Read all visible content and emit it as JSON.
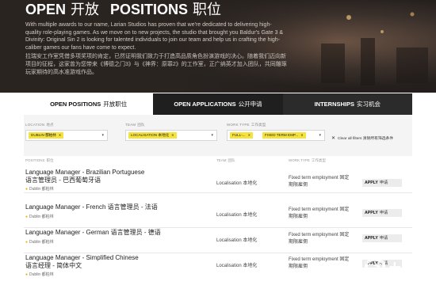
{
  "hero": {
    "title_open": "OPEN",
    "title_open_cn": "开放",
    "title_positions": "POSITIONS",
    "title_positions_cn": "职位",
    "intro_en": "With multiple awards to our name, Larian Studios has proven that we're dedicated to delivering high-quality role-playing games. As we move on to new projects, the studio that brought you Baldur's Gate 3 & Divinity: Original Sin 2 is looking for talented individuals to join our team and help us in crafting the high-caliber games our fans have come to expect.",
    "intro_cn": "拉瑞安工作室凭借多项奖项的肯定，已然证明我们致力于打造高品质角色扮演游戏的决心。随着我们迈向新项目的征程，这家曾为您带来《博德之门3》与《神界：原罪2》的工作室，正广纳英才加入团队，共同雕琢玩家期待的高水准游戏作品。"
  },
  "tabs": [
    {
      "label": "OPEN POSITIONS",
      "label_cn": "开放职位"
    },
    {
      "label": "OPEN APPLICATIONS",
      "label_cn": "公开申请"
    },
    {
      "label": "INTERNSHIPS",
      "label_cn": "实习机会"
    }
  ],
  "filters": {
    "location": {
      "label": "LOCATION",
      "label_cn": "地点",
      "chip": "DUBLIN 都柏林"
    },
    "team": {
      "label": "TEAM",
      "label_cn": "团队",
      "chip": "LOCALISATION 本地化"
    },
    "work_type": {
      "label": "WORK TYPE",
      "label_cn": "工作类型",
      "chip1": "FULL-...",
      "chip2": "FIXED TERM EMP..."
    },
    "clear_all": "Clear all filters",
    "clear_all_cn": "清除所有筛选条件"
  },
  "table": {
    "headers": {
      "positions": "POSITIONS",
      "positions_cn": "职位",
      "team": "TEAM",
      "team_cn": "团队",
      "work_type": "WORK TYPE",
      "work_type_cn": "工作类型"
    },
    "apply_label": "APPLY",
    "apply_label_cn": "申请",
    "rows": [
      {
        "title_en": "Language Manager - Brazilian Portuguese",
        "title_cn": "语言管理员 - 巴西葡萄牙语",
        "location": "Dublin 都柏林",
        "team": "Localisation 本地化",
        "type1": "Fixed term employment 固定",
        "type2": "期限雇佣"
      },
      {
        "title_en": "Language Manager - French",
        "title_cn": "语言管理员 - 法语",
        "location": "Dublin 都柏林",
        "team": "Localisation 本地化",
        "type1": "Fixed term employment 固定",
        "type2": "期限雇佣"
      },
      {
        "title_en": "Language Manager - German",
        "title_cn": "语言管理员 - 德语",
        "location": "Dublin 都柏林",
        "team": "Localisation 本地化",
        "type1": "Fixed term employment 固定",
        "type2": "期限雇佣"
      },
      {
        "title_en": "Language Manager - Simplified Chinese",
        "title_cn": "语言经理 - 简体中文",
        "location": "Dublin 都柏林",
        "team": "Localisation 本地化",
        "type1": "Fixed term employment 固定",
        "type2": "期限雇佣"
      }
    ]
  },
  "watermark": {
    "text": "九游"
  },
  "colors": {
    "accent_yellow": "#f5e23c",
    "hero_bg": "#2a2421",
    "tab_dark": "#1f1f1f"
  }
}
